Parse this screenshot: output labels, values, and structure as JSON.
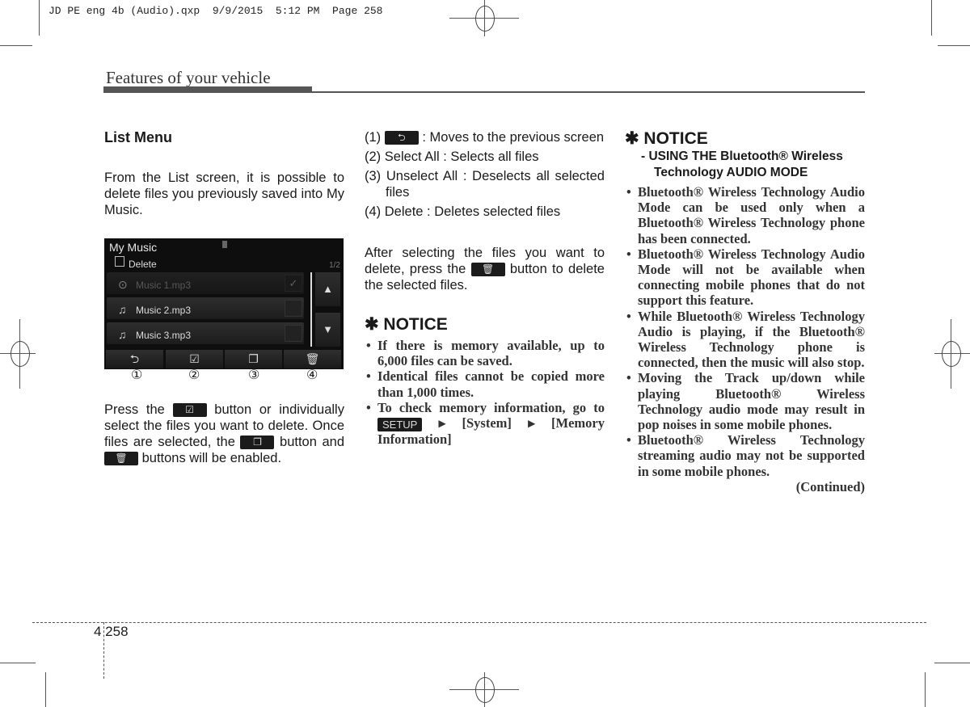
{
  "slug": "JD PE eng 4b (Audio).qxp  9/9/2015  5:12 PM  Page 258",
  "header": {
    "section_title": "Features of your vehicle"
  },
  "col1": {
    "heading": "List Menu",
    "intro": "From the List screen, it is possible to delete files you previously saved into My Music.",
    "screen": {
      "title": "My Music",
      "subtitle": "Delete",
      "page": "1/2",
      "rows": [
        {
          "name": "Music 1.mp3",
          "icon": "play-circle-icon",
          "checked": true
        },
        {
          "name": "Music 2.mp3",
          "icon": "music-note-icon",
          "checked": false
        },
        {
          "name": "Music 3.mp3",
          "icon": "music-note-icon",
          "checked": false
        }
      ],
      "up": "▲",
      "down": "▼",
      "buttons": [
        "⮌",
        "☑",
        "❐",
        "🗑"
      ],
      "callouts": [
        "①",
        "②",
        "③",
        "④"
      ]
    },
    "para_a": "Press the",
    "para_b": "button or individually select the files you want to delete. Once files are selected, the",
    "para_c": "button and",
    "para_d": "buttons will be enabled."
  },
  "col2": {
    "items": [
      {
        "num": "(1)",
        "text": ": Moves to the previous screen"
      },
      {
        "num": "(2)",
        "text": "Select All : Selects all files"
      },
      {
        "num": "(3)",
        "text": "Unselect All : Deselects all selected files"
      },
      {
        "num": "(4)",
        "text": "Delete : Deletes selected files"
      }
    ],
    "after_a": "After selecting the files you want to delete, press the",
    "after_b": "button to delete the selected files.",
    "notice_title": "✱ NOTICE",
    "notice_items": [
      "If there is memory available, up to 6,000 files can be saved.",
      "Identical files cannot be copied more than 1,000 times."
    ],
    "notice_setup_a": "To check memory information, go to",
    "setup_label": "SETUP",
    "notice_setup_b": "▸ [System] ▸ [Memory Information]"
  },
  "col3": {
    "notice_title": "✱ NOTICE",
    "subtitle": "- USING THE Bluetooth® Wireless Technology AUDIO MODE",
    "items": [
      "Bluetooth® Wireless Technology Audio Mode can be used only when a Bluetooth® Wireless Technology phone has been connected.",
      "Bluetooth® Wireless Technology Audio Mode will not be available when connecting mobile phones that do not support this feature.",
      "While Bluetooth® Wireless Technology Audio is playing, if the Bluetooth® Wireless Technology phone is connected, then the music will also stop.",
      "Moving the Track up/down while playing Bluetooth® Wireless Technology audio mode may result in pop noises in some mobile phones.",
      "Bluetooth® Wireless Technology streaming audio may not be supported in some mobile phones."
    ],
    "continued": "(Continued)"
  },
  "footer": {
    "page_number": "4 258"
  }
}
